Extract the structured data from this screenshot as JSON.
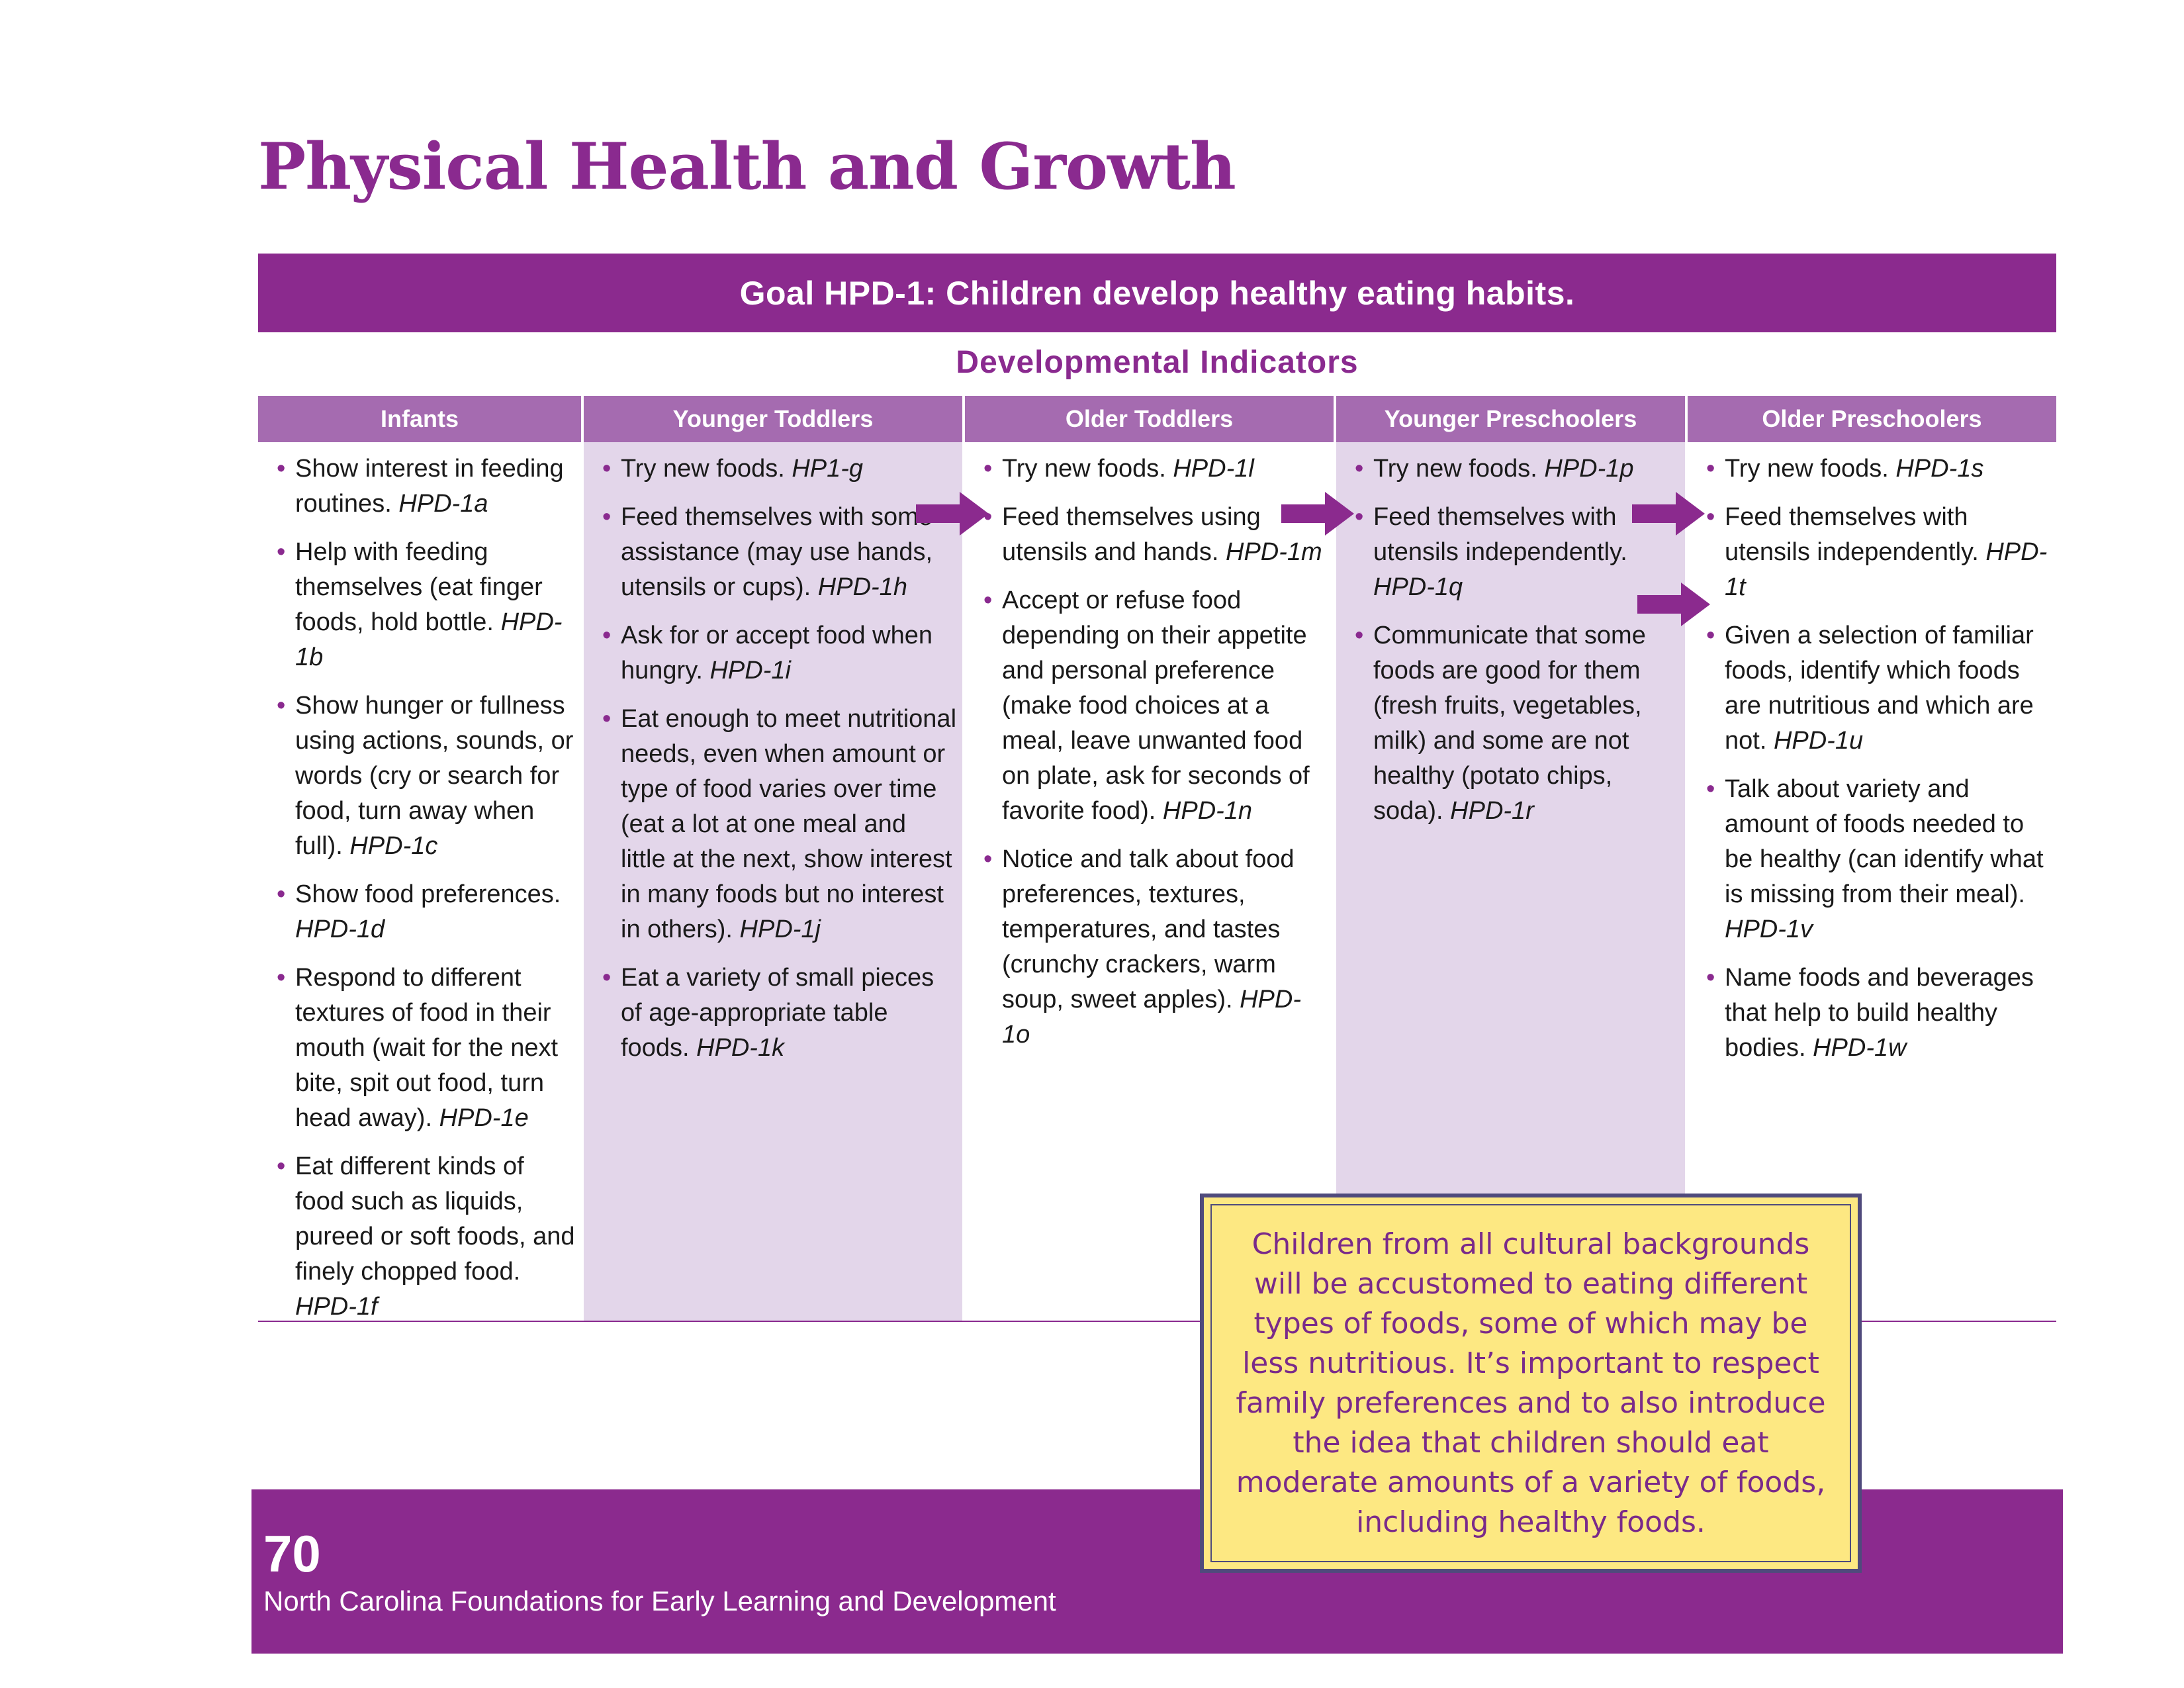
{
  "page": {
    "title": "Physical Health and Growth",
    "goal": "Goal HPD-1: Children develop healthy eating habits.",
    "section_heading": "Developmental Indicators"
  },
  "columns": [
    {
      "header": "Infants",
      "items": [
        {
          "text": "Show interest in feeding routines. ",
          "code": "HPD-1a"
        },
        {
          "text": "Help with feeding themselves (eat finger foods, hold bottle. ",
          "code": "HPD-1b"
        },
        {
          "text": "Show hunger or fullness using actions, sounds, or words (cry or search for food, turn away when full). ",
          "code": "HPD-1c"
        },
        {
          "text": "Show food preferences. ",
          "code": "HPD-1d"
        },
        {
          "text": "Respond to different textures of food in their mouth (wait for the next bite, spit out food, turn head away). ",
          "code": "HPD-1e"
        },
        {
          "text": "Eat different kinds of food such as liquids, pureed or soft foods, and finely chopped food. ",
          "code": "HPD-1f"
        }
      ]
    },
    {
      "header": "Younger Toddlers",
      "items": [
        {
          "text": "Try new foods. ",
          "code": "HP1-g"
        },
        {
          "text": "Feed themselves with some assistance (may use hands, utensils or cups). ",
          "code": "HPD-1h"
        },
        {
          "text": "Ask for or accept food when hungry. ",
          "code": "HPD-1i"
        },
        {
          "text": "Eat enough to meet nutritional needs, even when amount or type of food varies over time (eat a lot at one meal and little at the next, show interest in many foods but no interest in others). ",
          "code": "HPD-1j"
        },
        {
          "text": "Eat a variety of small pieces of age-appropriate table foods. ",
          "code": "HPD-1k"
        }
      ]
    },
    {
      "header": "Older Toddlers",
      "items": [
        {
          "text": "Try new foods. ",
          "code": "HPD-1l"
        },
        {
          "text": "Feed themselves using utensils and hands. ",
          "code": "HPD-1m"
        },
        {
          "text": "Accept or refuse food depending on their appetite and personal preference (make food choices at a meal, leave unwanted food on plate, ask for seconds of favorite food). ",
          "code": "HPD-1n"
        },
        {
          "text": "Notice and talk about food preferences, textures, temperatures, and tastes (crunchy crackers, warm soup, sweet apples). ",
          "code": "HPD-1o"
        }
      ]
    },
    {
      "header": "Younger Preschoolers",
      "items": [
        {
          "text": "Try new foods. ",
          "code": "HPD-1p"
        },
        {
          "text": "Feed themselves with utensils independently. ",
          "code": "HPD-1q"
        },
        {
          "text": "Communicate that some foods are good for them (fresh fruits, vegetables, milk) and some are not healthy (potato chips, soda). ",
          "code": "HPD-1r"
        }
      ]
    },
    {
      "header": "Older Preschoolers",
      "items": [
        {
          "text": "Try new foods. ",
          "code": "HPD-1s"
        },
        {
          "text": "Feed themselves with utensils independently. ",
          "code": "HPD-1t"
        },
        {
          "text": "Given a selection of familiar foods, identify which foods are nutritious and which are not. ",
          "code": "HPD-1u"
        },
        {
          "text": "Talk about variety and amount of foods needed to be healthy (can identify what is missing from their meal). ",
          "code": "HPD-1v"
        },
        {
          "text": "Name foods and beverages that help to build healthy bodies. ",
          "code": "HPD-1w"
        }
      ]
    }
  ],
  "note": "Children from all cultural backgrounds will be accustomed to eating different types of foods, some of which may be less nutritious. It’s important to respect family preferences and to also introduce the idea that children should eat moderate amounts of a variety of foods, including healthy foods.",
  "footer": {
    "page_number": "70",
    "publication": "North Carolina Foundations for Early Learning and Development"
  },
  "colors": {
    "purple": "#8b2a8e",
    "header_purple": "#a56bb0",
    "shade": "#e3d6ea",
    "note_bg": "#fde882"
  },
  "icons": [
    "right-arrow-icon"
  ]
}
